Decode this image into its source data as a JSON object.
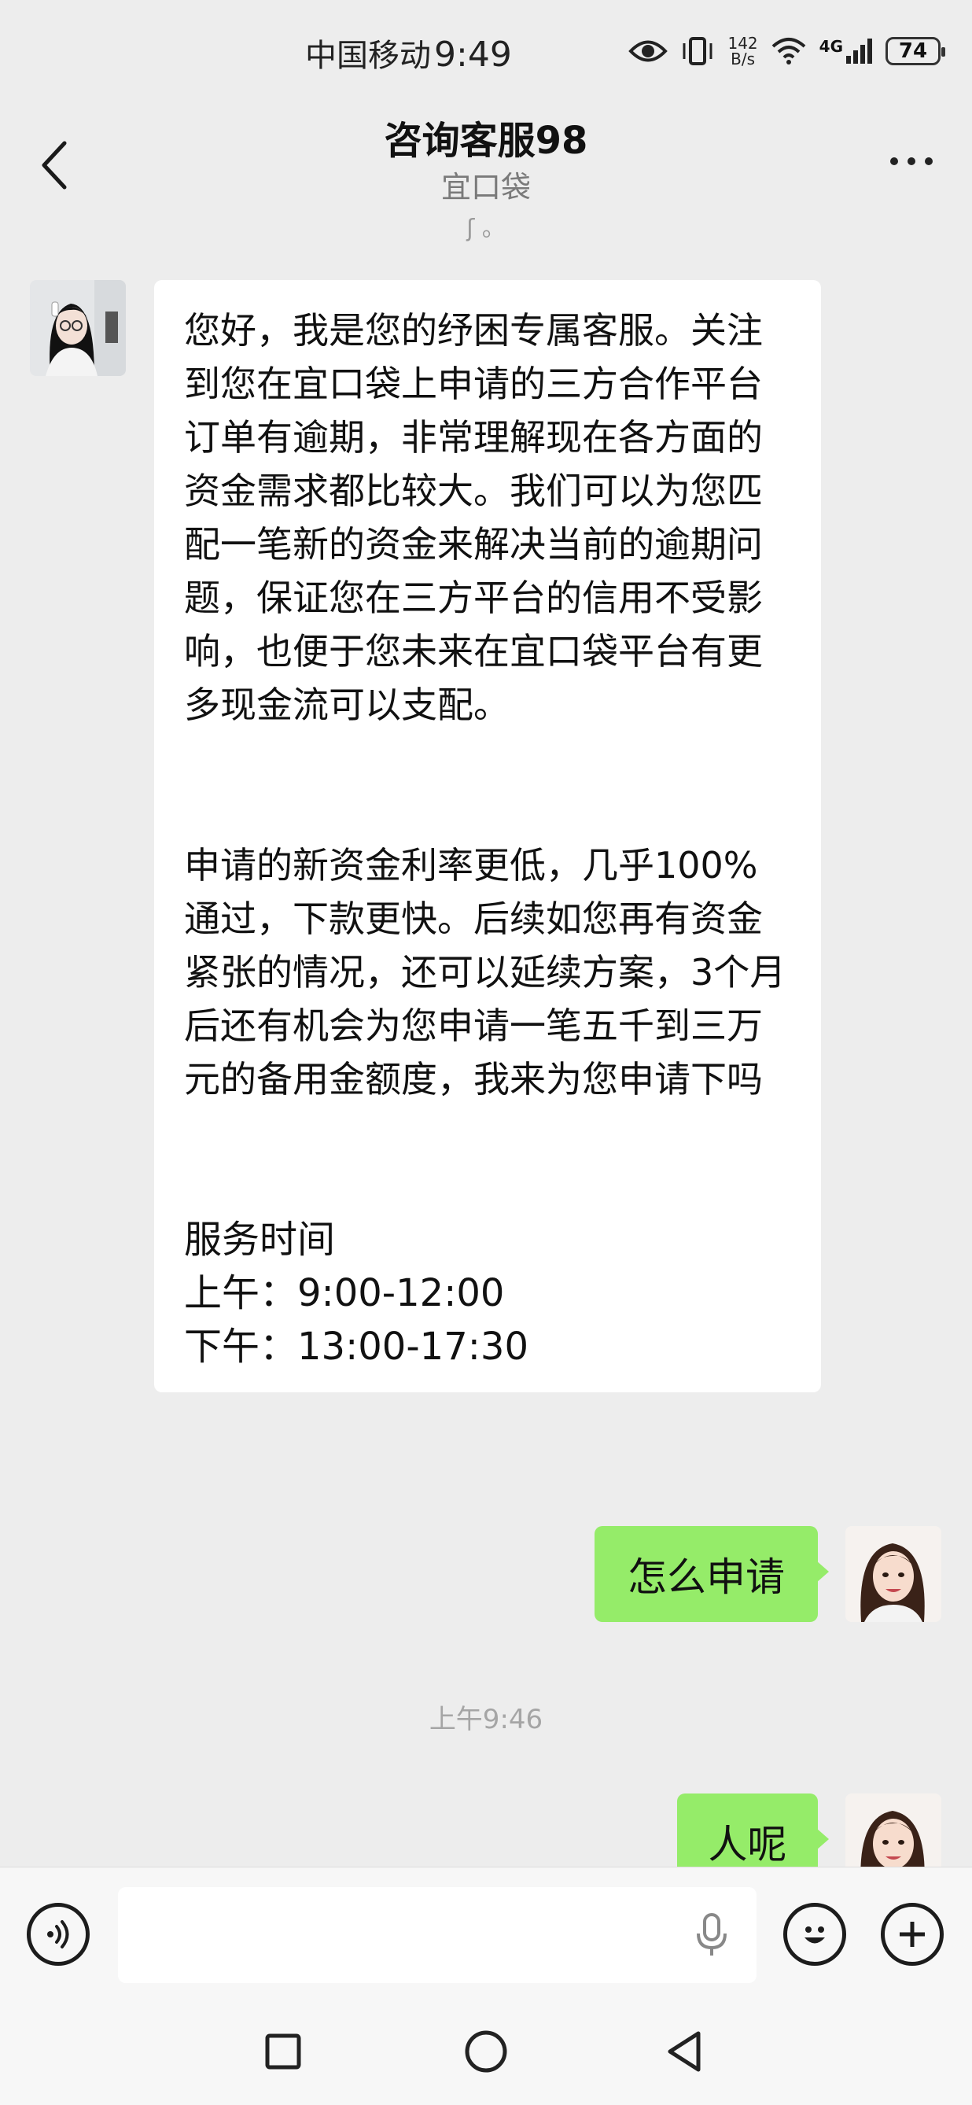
{
  "status_bar": {
    "carrier": "中国移动",
    "time": "9:49",
    "net_speed_value": "142",
    "net_speed_unit": "B/s",
    "network_type": "4G",
    "battery": "74",
    "icons": [
      "eye-icon",
      "vibrate-icon",
      "wifi-icon",
      "signal-icon",
      "battery-icon"
    ]
  },
  "header": {
    "title": "咨询客服98",
    "subtitle": "宜口袋",
    "mark": "ʃ 。"
  },
  "messages": {
    "incoming": {
      "p1": "您好，我是您的纾困专属客服。关注到您在宜口袋上申请的三方合作平台订单有逾期，非常理解现在各方面的资金需求都比较大。我们可以为您匹配一笔新的资金来解决当前的逾期问题，保证您在三方平台的信用不受影响，也便于您未来在宜口袋平台有更多现金流可以支配。",
      "p2": "申请的新资金利率更低，几乎100%通过，下款更快。后续如您再有资金紧张的情况，还可以延续方案，3个月后还有机会为您申请一笔五千到三万元的备用金额度，我来为您申请下吗",
      "service_title": "服务时间",
      "service_am": "上午：9:00-12:00",
      "service_pm": "下午：13:00-17:30"
    },
    "outgoing_1": "怎么申请",
    "timestamp": "上午9:46",
    "outgoing_2": "人呢"
  },
  "input_bar": {
    "voice_icon": "voice-icon",
    "mic_icon": "mic-icon",
    "emoji_icon": "emoji-icon",
    "plus_icon": "plus-icon"
  },
  "nav_bar": {
    "icons": [
      "recent-apps-icon",
      "home-icon",
      "back-icon"
    ]
  },
  "colors": {
    "background": "#ededed",
    "incoming_bubble": "#ffffff",
    "outgoing_bubble": "#95ec69"
  }
}
